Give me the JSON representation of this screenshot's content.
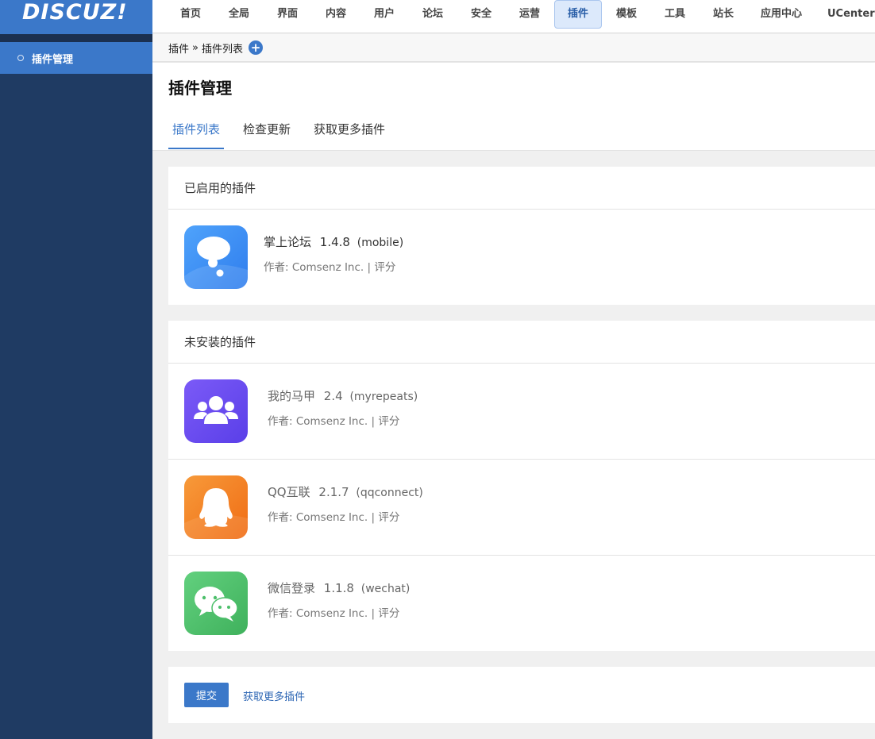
{
  "app": {
    "logo": "DISCUZ!"
  },
  "sidebar": {
    "items": [
      {
        "label": "插件管理"
      }
    ]
  },
  "topnav": {
    "items": [
      {
        "label": "首页"
      },
      {
        "label": "全局"
      },
      {
        "label": "界面"
      },
      {
        "label": "内容"
      },
      {
        "label": "用户"
      },
      {
        "label": "论坛"
      },
      {
        "label": "安全"
      },
      {
        "label": "运营"
      },
      {
        "label": "插件",
        "active": true
      },
      {
        "label": "模板"
      },
      {
        "label": "工具"
      },
      {
        "label": "站长"
      },
      {
        "label": "应用中心"
      },
      {
        "label": "UCenter"
      }
    ]
  },
  "breadcrumb": {
    "root": "插件",
    "sep": "»",
    "current": "插件列表",
    "add": "+"
  },
  "page": {
    "title": "插件管理",
    "tabs": [
      {
        "label": "插件列表",
        "active": true
      },
      {
        "label": "检查更新"
      },
      {
        "label": "获取更多插件"
      }
    ]
  },
  "enabled": {
    "header": "已启用的插件",
    "plugins": [
      {
        "name": "掌上论坛",
        "version": "1.4.8",
        "id": "(mobile)",
        "meta": "作者: Comsenz Inc. | 评分",
        "icon": "chat-bubble-icon",
        "color": "#3f8ef5"
      }
    ]
  },
  "uninstalled": {
    "header": "未安装的插件",
    "plugins": [
      {
        "name": "我的马甲",
        "version": "2.4",
        "id": "(myrepeats)",
        "meta": "作者: Comsenz Inc. | 评分",
        "icon": "users-group-icon",
        "color": "#6a4cf2"
      },
      {
        "name": "QQ互联",
        "version": "2.1.7",
        "id": "(qqconnect)",
        "meta": "作者: Comsenz Inc. | 评分",
        "icon": "qq-penguin-icon",
        "color": "#f37c22"
      },
      {
        "name": "微信登录",
        "version": "1.1.8",
        "id": "(wechat)",
        "meta": "作者: Comsenz Inc. | 评分",
        "icon": "wechat-icon",
        "color": "#4cbf6a"
      }
    ]
  },
  "footer": {
    "submit": "提交",
    "more_link": "获取更多插件"
  }
}
